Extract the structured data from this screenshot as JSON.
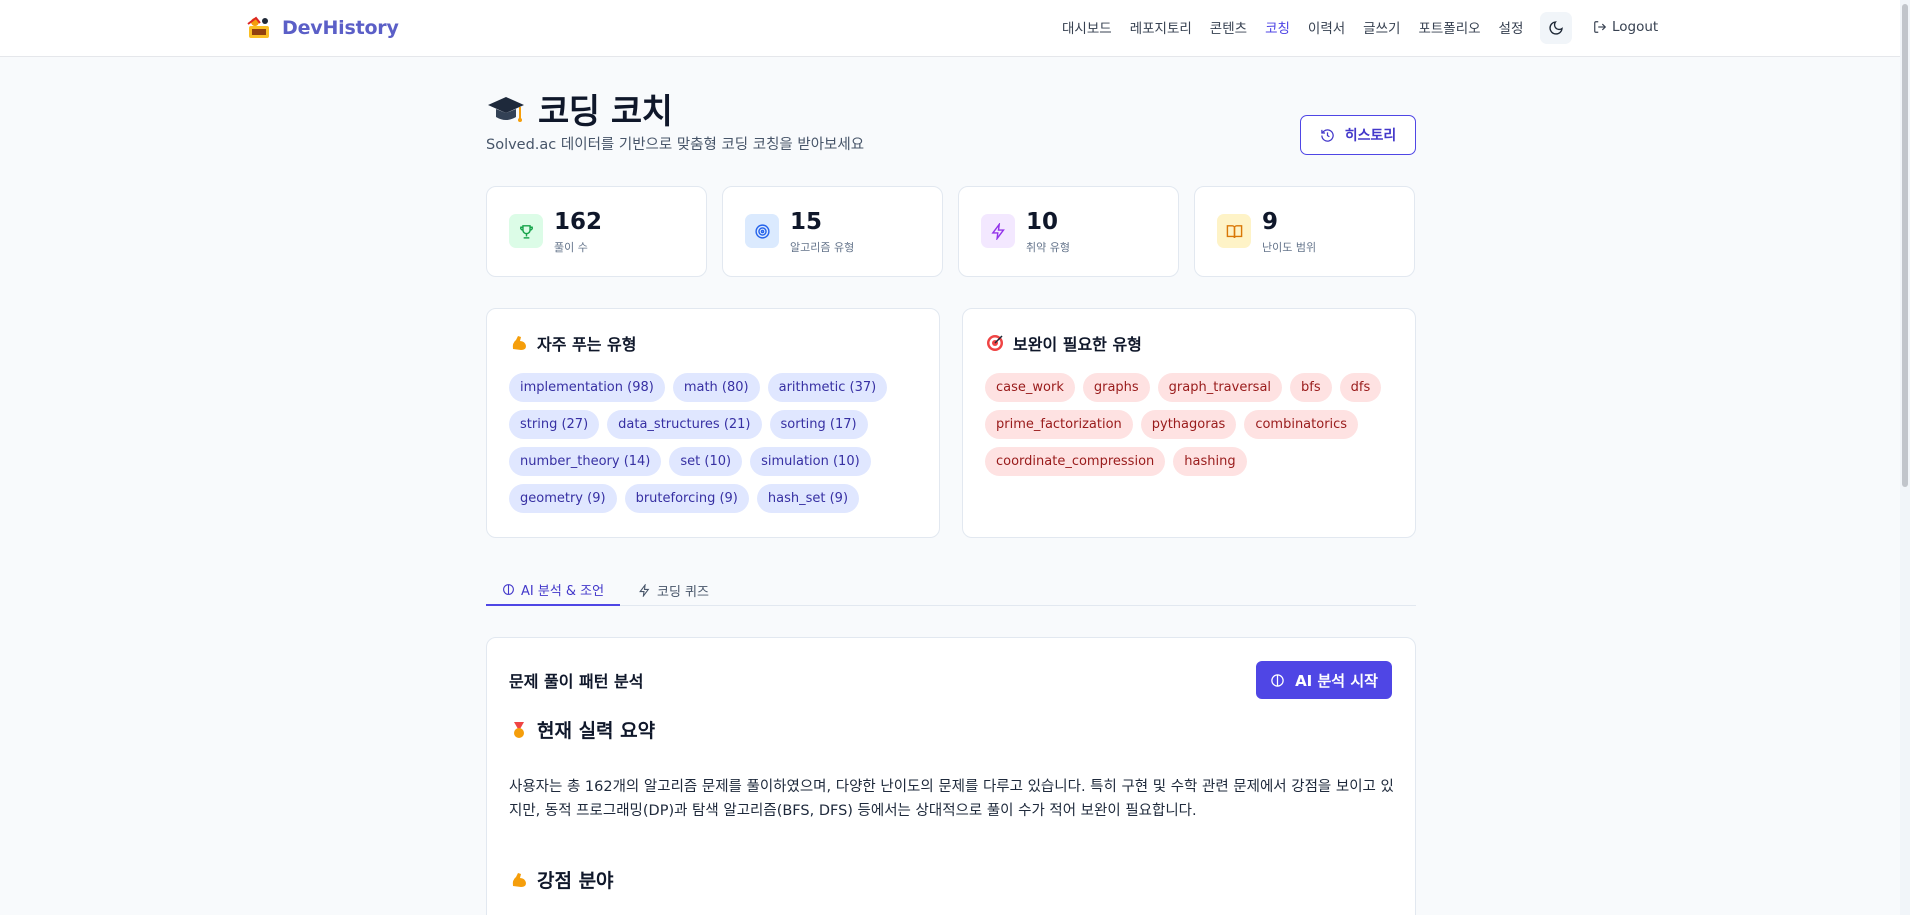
{
  "header": {
    "brand": "DevHistory",
    "nav": [
      "대시보드",
      "레포지토리",
      "콘텐츠",
      "코칭",
      "이력서",
      "글쓰기",
      "포트폴리오",
      "설정"
    ],
    "active_nav": "코칭",
    "logout": "Logout",
    "icons": {
      "logo": "devhistory-logo",
      "theme": "moon-icon",
      "logout": "logout-icon"
    }
  },
  "page": {
    "title": "코딩 코치",
    "subtitle": "Solved.ac 데이터를 기반으로 맞춤형 코딩 코칭을 받아보세요",
    "history_button": "히스토리"
  },
  "stats": [
    {
      "value": "162",
      "label": "풀이 수",
      "icon": "trophy-icon",
      "color": "#16a34a",
      "bg": "#dcfce7"
    },
    {
      "value": "15",
      "label": "알고리즘 유형",
      "icon": "target-icon",
      "color": "#2563eb",
      "bg": "#dbeafe"
    },
    {
      "value": "10",
      "label": "취약 유형",
      "icon": "lightning-icon",
      "color": "#9333ea",
      "bg": "#f3e8ff"
    },
    {
      "value": "9",
      "label": "난이도 범위",
      "icon": "book-icon",
      "color": "#d97706",
      "bg": "#fef3c7"
    }
  ],
  "frequent_types": {
    "title": "자주 푸는 유형",
    "tags": [
      "implementation (98)",
      "math (80)",
      "arithmetic (37)",
      "string (27)",
      "data_structures (21)",
      "sorting (17)",
      "number_theory (14)",
      "set (10)",
      "simulation (10)",
      "geometry (9)",
      "bruteforcing (9)",
      "hash_set (9)"
    ]
  },
  "weak_types": {
    "title": "보완이 필요한 유형",
    "tags": [
      "case_work",
      "graphs",
      "graph_traversal",
      "bfs",
      "dfs",
      "prime_factorization",
      "pythagoras",
      "combinatorics",
      "coordinate_compression",
      "hashing"
    ]
  },
  "tabs": [
    {
      "label": "AI 분석 & 조언",
      "active": true
    },
    {
      "label": "코딩 퀴즈",
      "active": false
    }
  ],
  "analysis": {
    "title": "문제 풀이 패턴 분석",
    "button": "AI 분석 시작",
    "summary_heading": "현재 실력 요약",
    "summary_text": "사용자는 총 162개의 알고리즘 문제를 풀이하였으며, 다양한 난이도의 문제를 다루고 있습니다. 특히 구현 및 수학 관련 문제에서 강점을 보이고 있지만, 동적 프로그래밍(DP)과 탐색 알고리즘(BFS, DFS) 등에서는 상대적으로 풀이 수가 적어 보완이 필요합니다.",
    "strength_heading": "강점 분야"
  }
}
